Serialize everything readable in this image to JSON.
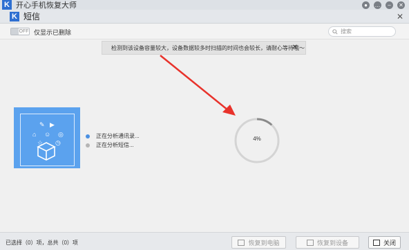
{
  "app": {
    "title": "开心手机恢复大师",
    "logo_letter": "K"
  },
  "titlebar": {
    "icons": [
      "wechat-icon",
      "chat-icon",
      "minimize-icon",
      "close-icon"
    ],
    "minimize": "–",
    "close": "✕"
  },
  "subwindow": {
    "title": "短信",
    "logo_letter": "K",
    "close": "✕"
  },
  "toolbar": {
    "toggle_state": "OFF",
    "toggle_label": "仅显示已删除",
    "search_placeholder": "搜索"
  },
  "tip": {
    "text": "检测到该设备容量较大，设备数据较多时扫描的时间也会较长，请耐心等待哦～",
    "close": "✕"
  },
  "status": {
    "items": [
      {
        "text": "正在分析通讯录...",
        "color": "#4a90e2"
      },
      {
        "text": "正在分析短信...",
        "color": "#b5b5b5"
      }
    ]
  },
  "progress": {
    "percent_label": "4%",
    "value": 0.04
  },
  "footer": {
    "selection_info": "已选择（0）项，总共（0）项",
    "restore_pc": "恢复到电脑",
    "restore_device": "恢复到设备",
    "close": "关闭"
  },
  "colors": {
    "accent": "#2e6fd1",
    "device_blue": "#5ba2ee",
    "arrow": "#e8322b"
  }
}
